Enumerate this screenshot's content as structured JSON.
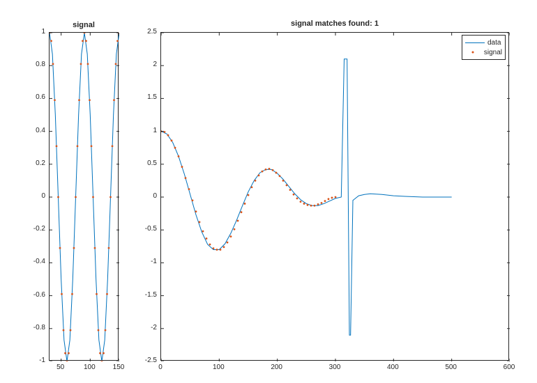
{
  "left": {
    "title": "signal",
    "xlim": [
      30,
      150
    ],
    "ylim": [
      -1,
      1
    ],
    "xticks": [
      50,
      100,
      150
    ],
    "yticks": [
      -1,
      -0.8,
      -0.6,
      -0.4,
      -0.2,
      0,
      0.2,
      0.4,
      0.6,
      0.8,
      1
    ]
  },
  "right": {
    "title": "signal matches found: 1",
    "xlim": [
      0,
      600
    ],
    "ylim": [
      -2.5,
      2.5
    ],
    "xticks": [
      0,
      100,
      200,
      300,
      400,
      500,
      600
    ],
    "yticks": [
      -2.5,
      -2,
      -1.5,
      -1,
      -0.5,
      0,
      0.5,
      1,
      1.5,
      2,
      2.5
    ]
  },
  "legend": {
    "items": [
      "data",
      "signal"
    ]
  },
  "colors": {
    "data": "#0072BD",
    "signal": "#D95319",
    "axis": "#262626"
  },
  "chart_data": [
    {
      "type": "line",
      "panel": "left",
      "title": "signal",
      "xlabel": "",
      "ylabel": "",
      "xlim": [
        30,
        150
      ],
      "ylim": [
        -1,
        1
      ],
      "series": [
        {
          "name": "signal-line",
          "style": "line",
          "color": "#0072BD",
          "x": [
            30,
            35,
            40,
            45,
            50,
            55,
            60,
            65,
            70,
            75,
            80,
            85,
            90,
            95,
            100,
            105,
            110,
            115,
            120,
            125,
            130,
            135,
            140,
            145,
            150
          ],
          "y": [
            1.0,
            0.87,
            0.5,
            0.0,
            -0.5,
            -0.87,
            -1.0,
            -0.87,
            -0.5,
            0.0,
            0.5,
            0.87,
            1.0,
            0.87,
            0.5,
            0.0,
            -0.5,
            -0.87,
            -1.0,
            -0.87,
            -0.5,
            0.0,
            0.5,
            0.87,
            1.0
          ]
        },
        {
          "name": "signal-dots",
          "style": "dots",
          "color": "#D95319",
          "x": [
            30,
            33,
            36,
            39,
            42,
            45,
            48,
            51,
            54,
            57,
            60,
            63,
            66,
            69,
            72,
            75,
            78,
            81,
            84,
            87,
            90,
            93,
            96,
            99,
            102,
            105,
            108,
            111,
            114,
            117,
            120,
            123,
            126,
            129,
            132,
            135,
            138,
            141,
            144,
            147,
            150
          ],
          "y": [
            1.0,
            0.95,
            0.81,
            0.59,
            0.31,
            0.0,
            -0.31,
            -0.59,
            -0.81,
            -0.95,
            -1.0,
            -0.95,
            -0.81,
            -0.59,
            -0.31,
            0.0,
            0.31,
            0.59,
            0.81,
            0.95,
            1.0,
            0.95,
            0.81,
            0.59,
            0.31,
            0.0,
            -0.31,
            -0.59,
            -0.81,
            -0.95,
            -1.0,
            -0.95,
            -0.81,
            -0.59,
            -0.31,
            0.0,
            0.31,
            0.59,
            0.81,
            0.95,
            1.0
          ]
        }
      ]
    },
    {
      "type": "line",
      "panel": "right",
      "title": "signal matches found: 1",
      "xlabel": "",
      "ylabel": "",
      "xlim": [
        0,
        600
      ],
      "ylim": [
        -2.5,
        2.5
      ],
      "series": [
        {
          "name": "data",
          "style": "line",
          "color": "#0072BD",
          "x": [
            0,
            10,
            20,
            30,
            40,
            50,
            60,
            70,
            80,
            90,
            100,
            110,
            120,
            130,
            140,
            150,
            160,
            170,
            180,
            190,
            200,
            210,
            220,
            230,
            240,
            250,
            260,
            270,
            280,
            290,
            300,
            310,
            315,
            316,
            317,
            320,
            324,
            325,
            326,
            330,
            340,
            350,
            360,
            380,
            400,
            420,
            450,
            480,
            500
          ],
          "y": [
            1.0,
            0.96,
            0.83,
            0.62,
            0.35,
            0.04,
            -0.27,
            -0.53,
            -0.72,
            -0.8,
            -0.8,
            -0.71,
            -0.55,
            -0.35,
            -0.13,
            0.08,
            0.25,
            0.37,
            0.42,
            0.42,
            0.36,
            0.27,
            0.16,
            0.05,
            -0.04,
            -0.1,
            -0.13,
            -0.13,
            -0.1,
            -0.06,
            -0.02,
            0.0,
            2.1,
            2.1,
            2.1,
            2.1,
            -2.1,
            -2.1,
            -2.1,
            -0.05,
            0.02,
            0.04,
            0.05,
            0.04,
            0.02,
            0.01,
            0.0,
            0.0,
            0.0
          ]
        },
        {
          "name": "signal",
          "style": "dots",
          "color": "#D95319",
          "x": [
            0,
            6,
            12,
            18,
            24,
            30,
            36,
            42,
            48,
            54,
            60,
            66,
            72,
            78,
            84,
            90,
            96,
            102,
            108,
            114,
            120,
            126,
            132,
            138,
            144,
            150,
            156,
            162,
            168,
            174,
            180,
            186,
            192,
            198,
            204,
            210,
            216,
            222,
            228,
            234,
            240,
            246,
            252,
            258,
            264,
            270,
            276,
            282,
            288,
            294,
            300
          ],
          "y": [
            1.0,
            0.99,
            0.94,
            0.86,
            0.75,
            0.62,
            0.46,
            0.29,
            0.12,
            -0.05,
            -0.22,
            -0.38,
            -0.52,
            -0.63,
            -0.72,
            -0.78,
            -0.8,
            -0.8,
            -0.76,
            -0.69,
            -0.6,
            -0.49,
            -0.36,
            -0.23,
            -0.1,
            0.03,
            0.15,
            0.25,
            0.33,
            0.39,
            0.42,
            0.43,
            0.41,
            0.37,
            0.32,
            0.25,
            0.18,
            0.11,
            0.04,
            -0.02,
            -0.07,
            -0.1,
            -0.12,
            -0.13,
            -0.13,
            -0.11,
            -0.09,
            -0.06,
            -0.03,
            -0.01,
            0.0
          ]
        }
      ]
    }
  ]
}
